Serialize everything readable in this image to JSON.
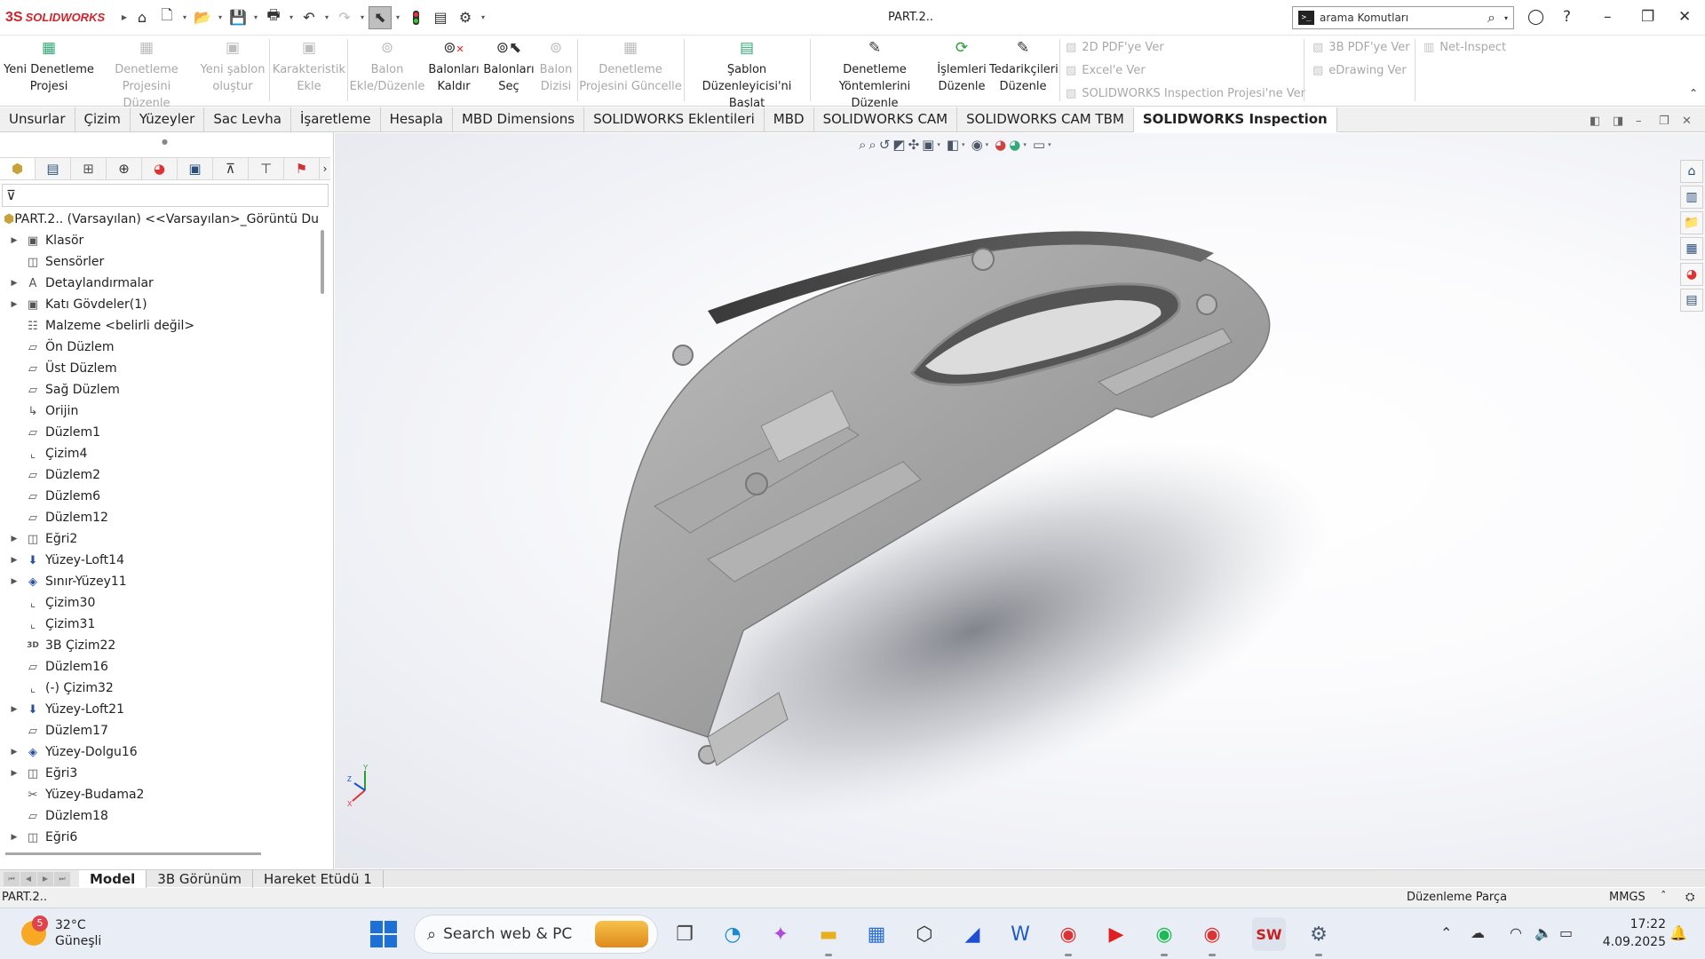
{
  "app": {
    "brand_ds": "3S",
    "brand": "SOLIDWORKS",
    "document_title": "PART.2..",
    "search_placeholder": "arama Komutları",
    "prompt_icon": ">_"
  },
  "quick_access": [
    "home-icon",
    "new-document-icon",
    "open-icon",
    "save-icon",
    "print-icon",
    "undo-icon",
    "redo-icon",
    "select-icon",
    "rebuild-icon",
    "file-properties-icon",
    "options-icon"
  ],
  "ribbon": {
    "buttons": [
      {
        "line1": "Yeni Denetleme",
        "line2": "Projesi",
        "enabled": true
      },
      {
        "line1": "Denetleme",
        "line2": "Projesini Düzenle",
        "enabled": false
      },
      {
        "line1": "Yeni şablon",
        "line2": "oluştur",
        "enabled": false
      },
      {
        "line1": "Karakteristik",
        "line2": "Ekle",
        "enabled": false
      },
      {
        "line1": "Balon",
        "line2": "Ekle/Düzenle",
        "enabled": false
      },
      {
        "line1": "Balonları",
        "line2": "Kaldır",
        "enabled": true
      },
      {
        "line1": "Balonları",
        "line2": "Seç",
        "enabled": true
      },
      {
        "line1": "Balon",
        "line2": "Dizisi",
        "enabled": false
      },
      {
        "line1": "Denetleme",
        "line2": "Projesini Güncelle",
        "enabled": false
      },
      {
        "line1": "Şablon",
        "line2": "Düzenleyicisi'ni Başlat",
        "enabled": true
      },
      {
        "line1": "Denetleme",
        "line2": "Yöntemlerini Düzenle",
        "enabled": true
      },
      {
        "line1": "İşlemleri",
        "line2": "Düzenle",
        "enabled": true
      },
      {
        "line1": "Tedarikçileri",
        "line2": "Düzenle",
        "enabled": true
      }
    ],
    "export_2d_pdf": "2D PDF'ye Ver",
    "export_excel": "Excel'e Ver",
    "export_sw_inspection": "SOLIDWORKS Inspection Projesi'ne Ver",
    "export_3d_pdf": "3B PDF'ye Ver",
    "export_edrawing": "eDrawing Ver",
    "net_inspect": "Net-Inspect"
  },
  "tabs": [
    "Unsurlar",
    "Çizim",
    "Yüzeyler",
    "Sac Levha",
    "İşaretleme",
    "Hesapla",
    "MBD Dimensions",
    "SOLIDWORKS Eklentileri",
    "MBD",
    "SOLIDWORKS CAM",
    "SOLIDWORKS CAM TBM",
    "SOLIDWORKS Inspection"
  ],
  "active_tab": "SOLIDWORKS Inspection",
  "feature_tree": {
    "root": "PART.2.. (Varsayılan) <<Varsayılan>_Görüntü Duru",
    "items": [
      {
        "label": "Klasör",
        "expandable": true,
        "icon": "folder-icon"
      },
      {
        "label": "Sensörler",
        "expandable": false,
        "icon": "sensor-icon"
      },
      {
        "label": "Detaylandırmalar",
        "expandable": true,
        "icon": "annotation-icon"
      },
      {
        "label": "Katı Gövdeler(1)",
        "expandable": true,
        "icon": "solid-body-icon"
      },
      {
        "label": "Malzeme <belirli değil>",
        "expandable": false,
        "icon": "material-icon"
      },
      {
        "label": "Ön Düzlem",
        "expandable": false,
        "icon": "plane-icon"
      },
      {
        "label": "Üst Düzlem",
        "expandable": false,
        "icon": "plane-icon"
      },
      {
        "label": "Sağ Düzlem",
        "expandable": false,
        "icon": "plane-icon"
      },
      {
        "label": "Orijin",
        "expandable": false,
        "icon": "origin-icon"
      },
      {
        "label": "Düzlem1",
        "expandable": false,
        "icon": "plane-icon"
      },
      {
        "label": "Çizim4",
        "expandable": false,
        "icon": "sketch-icon"
      },
      {
        "label": "Düzlem2",
        "expandable": false,
        "icon": "plane-icon"
      },
      {
        "label": "Düzlem6",
        "expandable": false,
        "icon": "plane-icon"
      },
      {
        "label": "Düzlem12",
        "expandable": false,
        "icon": "plane-icon"
      },
      {
        "label": "Eğri2",
        "expandable": true,
        "icon": "curve-icon"
      },
      {
        "label": "Yüzey-Loft14",
        "expandable": true,
        "icon": "loft-icon"
      },
      {
        "label": "Sınır-Yüzey11",
        "expandable": true,
        "icon": "boundary-surface-icon"
      },
      {
        "label": "Çizim30",
        "expandable": false,
        "icon": "sketch-icon"
      },
      {
        "label": "Çizim31",
        "expandable": false,
        "icon": "sketch-icon"
      },
      {
        "label": "3B Çizim22",
        "expandable": false,
        "icon": "3d-sketch-icon"
      },
      {
        "label": "Düzlem16",
        "expandable": false,
        "icon": "plane-icon"
      },
      {
        "label": "(-) Çizim32",
        "expandable": false,
        "icon": "sketch-icon"
      },
      {
        "label": "Yüzey-Loft21",
        "expandable": true,
        "icon": "loft-icon"
      },
      {
        "label": "Düzlem17",
        "expandable": false,
        "icon": "plane-icon"
      },
      {
        "label": "Yüzey-Dolgu16",
        "expandable": true,
        "icon": "fill-surface-icon"
      },
      {
        "label": "Eğri3",
        "expandable": true,
        "icon": "curve-icon"
      },
      {
        "label": "Yüzey-Budama2",
        "expandable": false,
        "icon": "trim-surface-icon"
      },
      {
        "label": "Düzlem18",
        "expandable": false,
        "icon": "plane-icon"
      },
      {
        "label": "Eğri6",
        "expandable": true,
        "icon": "curve-icon"
      }
    ]
  },
  "bottom_tabs": [
    "Model",
    "3B Görünüm",
    "Hareket Etüdü 1"
  ],
  "status": {
    "left": "PART.2..",
    "mode": "Düzenleme Parça",
    "units": "MMGS",
    "units_arrow": "ˆ"
  },
  "triad": {
    "x": "X",
    "y": "Y",
    "z": "Z"
  },
  "taskbar": {
    "temperature": "32°C",
    "weather": "Güneşli",
    "weather_badge": "5",
    "search": "Search web & PC",
    "time": "17:22",
    "date": "4.09.2025"
  }
}
